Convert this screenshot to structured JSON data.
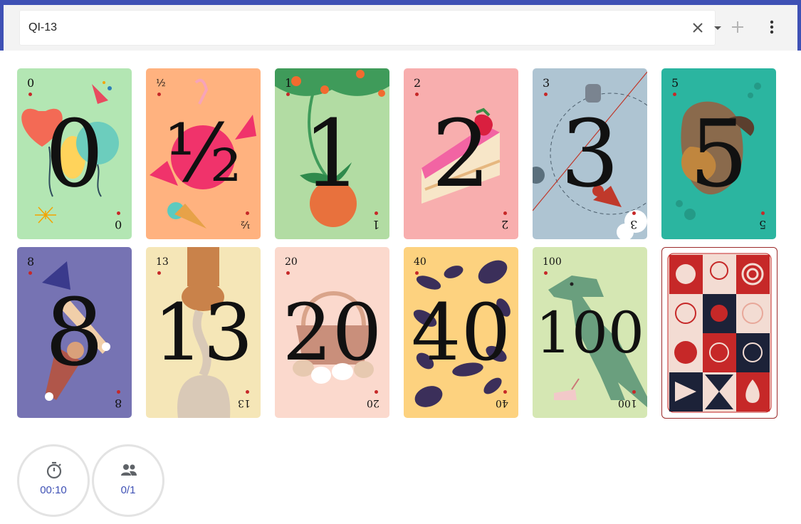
{
  "header": {
    "session_value": "QI-13",
    "clear_icon": "close-icon",
    "dropdown_icon": "arrow-drop-down-icon",
    "add_icon": "add-icon",
    "more_icon": "more-vert-icon",
    "accent_color": "#3f51b5"
  },
  "cards": [
    {
      "value": "0",
      "corner": "0",
      "color": "#b3e6b3"
    },
    {
      "value": "½",
      "corner": "½",
      "color": "#ffb27f"
    },
    {
      "value": "1",
      "corner": "1",
      "color": "#b2dca3"
    },
    {
      "value": "2",
      "corner": "2",
      "color": "#f8aeae"
    },
    {
      "value": "3",
      "corner": "3",
      "color": "#aec4d2"
    },
    {
      "value": "5",
      "corner": "5",
      "color": "#2bb5a0"
    },
    {
      "value": "8",
      "corner": "8",
      "color": "#7673b3"
    },
    {
      "value": "13",
      "corner": "13",
      "color": "#f5e6b7"
    },
    {
      "value": "20",
      "corner": "20",
      "color": "#fbd9cd"
    },
    {
      "value": "40",
      "corner": "40",
      "color": "#fdd27f"
    },
    {
      "value": "100",
      "corner": "100",
      "color": "#d5e7b3"
    }
  ],
  "card_back": {
    "name": "card-back",
    "color": "#c62828"
  },
  "status": {
    "timer_icon": "timer-icon",
    "timer_value": "00:10",
    "players_icon": "people-icon",
    "players_value": "0/1",
    "value_color": "#3f51b5"
  }
}
